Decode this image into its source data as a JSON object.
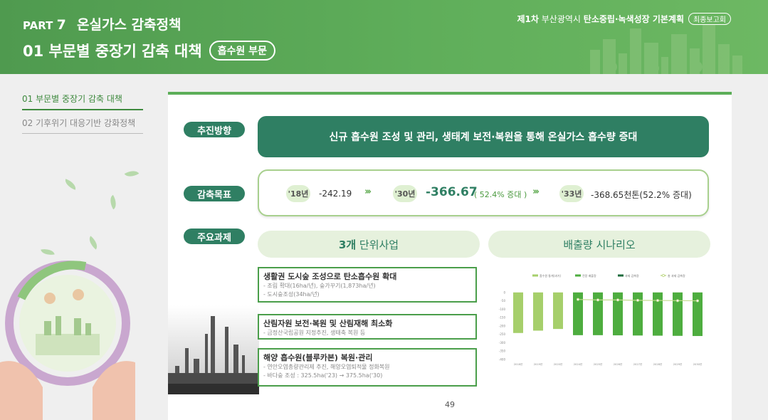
{
  "header": {
    "part_label": "PART",
    "part_number": "7",
    "part_title": "온실가스 감축정책",
    "section_title": "01 부문별 중장기 감축 대책",
    "section_badge": "흡수원 부문",
    "doc_prefix": "제1차",
    "doc_city": "부산광역시",
    "doc_title": "탄소중립·녹색성장 기본계획",
    "doc_badge": "최종보고회"
  },
  "sidebar": {
    "items": [
      {
        "label": "01 부문별 중장기 감축 대책",
        "active": true
      },
      {
        "label": "02 기후위기 대응기반 강화정책",
        "active": false
      }
    ]
  },
  "main": {
    "direction_label": "추진방향",
    "direction_text": "신규 흡수원 조성 및 관리, 생태계 보전·복원을 통해 온실가스 흡수량 증대",
    "target_label": "감축목표",
    "targets": [
      {
        "year": "'18년",
        "value": "-242.19"
      },
      {
        "year": "'30년",
        "value": "-366.67",
        "note": "( 52.4% 증대 )"
      },
      {
        "year": "'33년",
        "value": "-368.65천톤(52.2% 증대)"
      }
    ],
    "arrow_glyph": "›››",
    "tasks_label": "주요과제",
    "tab_units_bold": "3개",
    "tab_units_rest": " 단위사업",
    "tab_scenario": "배출량 시나리오",
    "tasks": [
      {
        "title": "생활권 도시숲 조성으로 탄소흡수원 확대",
        "subs": [
          "- 조림 확대(16ha/년), 숲가꾸기(1,873ha/년)",
          "- 도시숲조성(34ha/년)"
        ]
      },
      {
        "title": "산림자원 보전·복원 및 산림재해 최소화",
        "subs": [
          "- 금정산국립공원 지정추진, 생태축 복원 등"
        ]
      },
      {
        "title": "해양 흡수원(블루카본) 복원·관리",
        "subs": [
          "- 연안오염총량관리제 추진, 해양오염퇴적물 정화복원",
          "- 바다숲 조성 : 325.5ha('23) → 375.5ha('30)"
        ]
      }
    ],
    "page_number": "49"
  },
  "chart_data": {
    "type": "bar",
    "legend": [
      "흡수원 통계(과거)",
      "전망 배출량",
      "과제 감축량",
      "총 과제 감축량"
    ],
    "legend_position": "top",
    "categories": [
      "2018년",
      "2019년",
      "2020년",
      "2024년",
      "2025년",
      "2026년",
      "2027년",
      "2028년",
      "2029년",
      "2030년"
    ],
    "series": [
      {
        "name": "흡수원 통계(과거)",
        "values": [
          -242,
          -228,
          -218,
          null,
          null,
          null,
          null,
          null,
          null,
          null
        ]
      },
      {
        "name": "전망 배출량",
        "values": [
          null,
          null,
          null,
          -255,
          -255,
          -256,
          -257,
          -258,
          -259,
          -260
        ]
      },
      {
        "name": "과제 감축량",
        "values": [
          null,
          null,
          null,
          -55,
          -58,
          -60,
          -62,
          -65,
          -66,
          -67
        ]
      },
      {
        "name": "총 과제 감축량",
        "values": [
          null,
          null,
          null,
          -42,
          -45,
          -45,
          -47,
          -48,
          -49,
          -50
        ]
      }
    ],
    "y_ticks": [
      "0",
      "-50",
      "-100",
      "-150",
      "-200",
      "-250",
      "-300",
      "-350",
      "-400"
    ],
    "ylim": [
      -400,
      50
    ],
    "colors": {
      "past": "#a6cf6b",
      "forecast": "#4ead3f",
      "reduction": "#1d6b3c",
      "total": "#c3db8f"
    }
  },
  "colors": {
    "brand": "#5cae58",
    "pill": "#2f7f63",
    "light": "#e6f1dd"
  }
}
